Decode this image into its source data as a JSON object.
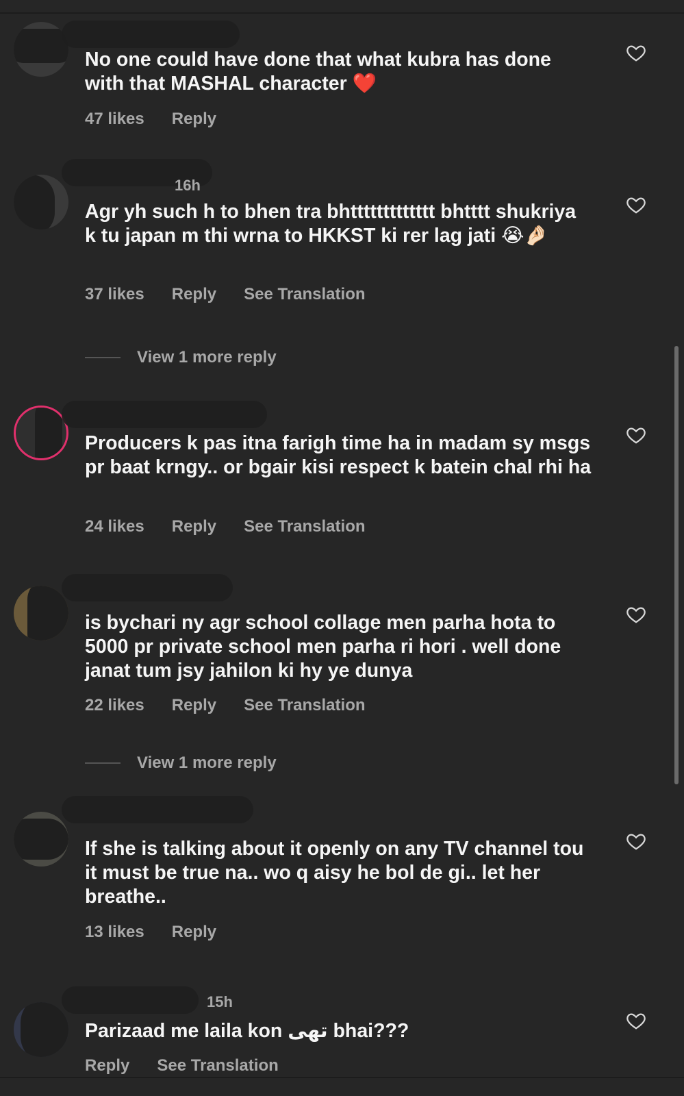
{
  "comments": [
    {
      "time": "",
      "text": "No one could have done that what kubra has done with that MASHAL character ❤️",
      "likes": "47 likes",
      "reply": "Reply",
      "translation": ""
    },
    {
      "time": "16h",
      "text": "Agr yh such h to bhen tra bhttttttttttttt bhtttt shukriya k tu japan m thi wrna to HKKST ki rer lag jati 😭🤌🏻",
      "likes": "37 likes",
      "reply": "Reply",
      "translation": "See Translation"
    },
    {
      "time": "",
      "text": "Producers k pas itna farigh time ha in madam sy msgs pr baat krngy.. or bgair kisi respect k batein chal rhi ha",
      "likes": "24 likes",
      "reply": "Reply",
      "translation": "See Translation"
    },
    {
      "time": "",
      "text": "is bychari ny agr school collage men parha hota to 5000 pr private school men parha ri hori . well done janat tum jsy jahilon ki hy ye dunya",
      "likes": "22 likes",
      "reply": "Reply",
      "translation": "See Translation"
    },
    {
      "time": "",
      "text": "If she is talking about it openly on any TV channel tou it must be true na.. wo q aisy he bol de gi.. let her breathe..",
      "likes": "13 likes",
      "reply": "Reply",
      "translation": ""
    },
    {
      "time": "15h",
      "text": "Parizaad me laila kon تھی bhai???",
      "likes": "",
      "reply": "Reply",
      "translation": "See Translation"
    }
  ],
  "view_more": {
    "label": "View 1 more reply"
  },
  "icons": {
    "like": "heart-outline-icon"
  },
  "colors": {
    "background": "#262626",
    "text": "#f5f5f5",
    "secondary": "#a8a8a8",
    "story_ring": "#e1306c"
  }
}
